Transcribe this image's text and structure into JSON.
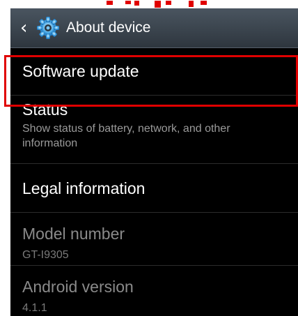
{
  "action_bar": {
    "title": "About device"
  },
  "items": [
    {
      "title": "Software update",
      "subtitle": ""
    },
    {
      "title": "Status",
      "subtitle": "Show status of battery, network, and other information"
    },
    {
      "title": "Legal information",
      "subtitle": ""
    },
    {
      "title": "Model number",
      "subtitle": "GT-I9305"
    },
    {
      "title": "Android version",
      "subtitle": "4.1.1"
    }
  ],
  "colors": {
    "highlight": "#e00000",
    "action_bar": "#3b444c",
    "list_background": "#000000",
    "caption_fragment": "#e00000"
  }
}
